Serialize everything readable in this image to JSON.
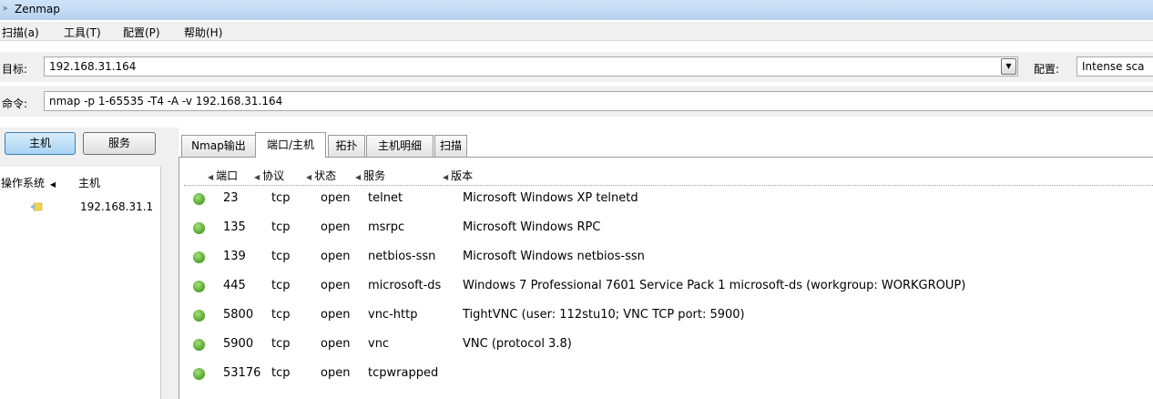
{
  "window": {
    "title": "Zenmap"
  },
  "menu": [
    {
      "label": "扫描(a)"
    },
    {
      "label": "工具(T)"
    },
    {
      "label": "配置(P)"
    },
    {
      "label": "帮助(H)"
    }
  ],
  "target": {
    "label": "目标:",
    "value": "192.168.31.164"
  },
  "profile": {
    "label": "配置:",
    "value": "Intense sca"
  },
  "command": {
    "label": "命令:",
    "value": "nmap -p 1-65535 -T4 -A -v 192.168.31.164"
  },
  "view_buttons": {
    "hosts": "主机",
    "services": "服务"
  },
  "host_list": {
    "col_os": "操作系统",
    "col_host": "主机",
    "hosts": [
      {
        "address": "192.168.31.1"
      }
    ]
  },
  "tabs": [
    {
      "label": "Nmap输出"
    },
    {
      "label": "端口/主机"
    },
    {
      "label": "拓扑"
    },
    {
      "label": "主机明细"
    },
    {
      "label": "扫描"
    }
  ],
  "ports_table": {
    "columns": {
      "port": "端口",
      "protocol": "协议",
      "state": "状态",
      "service": "服务",
      "version": "版本"
    },
    "rows": [
      {
        "port": "23",
        "protocol": "tcp",
        "state": "open",
        "service": "telnet",
        "version": "Microsoft Windows XP telnetd"
      },
      {
        "port": "135",
        "protocol": "tcp",
        "state": "open",
        "service": "msrpc",
        "version": "Microsoft Windows RPC"
      },
      {
        "port": "139",
        "protocol": "tcp",
        "state": "open",
        "service": "netbios-ssn",
        "version": "Microsoft Windows netbios-ssn"
      },
      {
        "port": "445",
        "protocol": "tcp",
        "state": "open",
        "service": "microsoft-ds",
        "version": "Windows 7 Professional 7601 Service Pack 1 microsoft-ds (workgroup: WORKGROUP)"
      },
      {
        "port": "5800",
        "protocol": "tcp",
        "state": "open",
        "service": "vnc-http",
        "version": "TightVNC (user: 112stu10; VNC TCP port: 5900)"
      },
      {
        "port": "5900",
        "protocol": "tcp",
        "state": "open",
        "service": "vnc",
        "version": "VNC (protocol 3.8)"
      },
      {
        "port": "53176",
        "protocol": "tcp",
        "state": "open",
        "service": "tcpwrapped",
        "version": ""
      }
    ]
  },
  "colors": {
    "open_status": "#4fa32a",
    "title_bar": "#b7d2ef",
    "active_button": "#a8d3f4"
  },
  "icons": {
    "app": "zenmap-icon",
    "os": "unknown-os-icon",
    "status": "status-dot-icon",
    "sort": "sort-arrow-icon",
    "dropdown": "chevron-down-icon"
  }
}
